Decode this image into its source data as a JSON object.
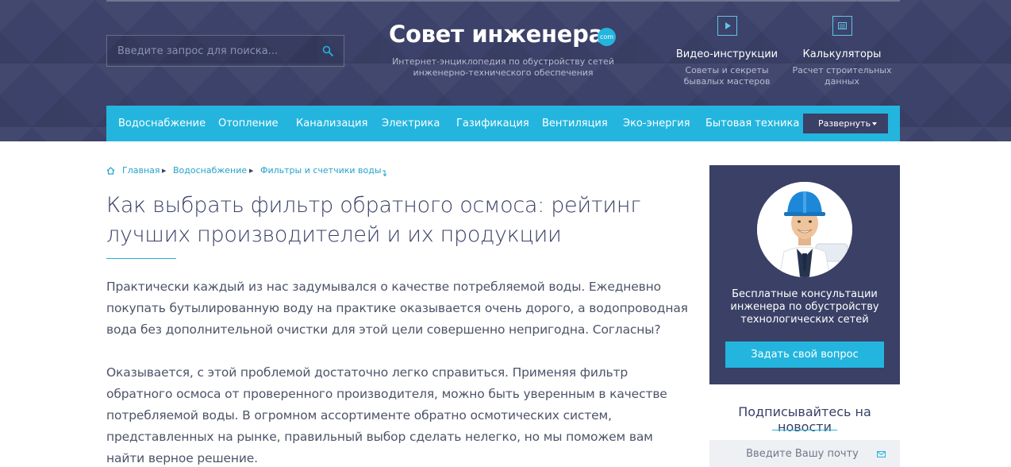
{
  "header": {
    "search_placeholder": "Введите запрос для поиска...",
    "logo_text": "Совет инженера",
    "logo_badge": "com",
    "tagline": "Интернет-энциклопедия по обустройству сетей инженерно-технического обеспечения",
    "links": [
      {
        "icon": "play-icon",
        "title": "Видео-инструкции",
        "subtitle": "Советы и секреты бывалых мастеров"
      },
      {
        "icon": "calculator-icon",
        "title": "Калькуляторы",
        "subtitle": "Расчет строительных данных"
      }
    ]
  },
  "nav": {
    "items": [
      "Водоснабжение",
      "Отопление",
      "Канализация",
      "Электрика",
      "Газификация",
      "Вентиляция",
      "Эко-энергия",
      "Бытовая техника"
    ],
    "expand_label": "Развернуть"
  },
  "breadcrumb": [
    "Главная",
    "Водоснабжение",
    "Фильтры и счетчики воды"
  ],
  "article": {
    "title": "Как выбрать фильтр обратного осмоса: рейтинг лучших производителей и их продукции",
    "paragraphs": [
      "Практически каждый из нас задумывался о качестве потребляемой воды. Ежедневно покупать бутылированную воду на практике оказывается очень дорого, а водопроводная вода без дополнительной очистки для этой цели совершенно непригодна. Согласны?",
      "Оказывается, с этой проблемой достаточно легко справиться. Применяя фильтр обратного осмоса от проверенного производителя, можно быть уверенным в качестве потребляемой воды. В огромном ассортименте обратно осмотических систем, представленных на рынке, правильный выбор сделать нелегко, но мы поможем вам найти верное решение."
    ]
  },
  "sidebar": {
    "consult_text": "Бесплатные консультации инженера по обустройству технологических сетей",
    "ask_button": "Задать свой вопрос",
    "subscribe_title": "Подписывайтесь на новости",
    "email_placeholder": "Введите Вашу почту"
  },
  "colors": {
    "header_bg": "#3a4066",
    "accent": "#23b5de",
    "title": "#3a4066",
    "body_text": "#4d5468"
  }
}
